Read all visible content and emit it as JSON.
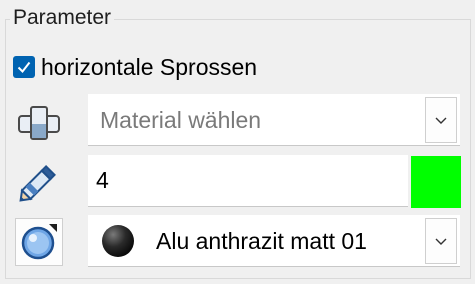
{
  "group": {
    "title": "Parameter"
  },
  "checkbox": {
    "label": "horizontale Sprossen",
    "checked": true
  },
  "material_combo": {
    "placeholder": "Material wählen"
  },
  "width_field": {
    "value": "4"
  },
  "color": {
    "value": "#00ff00"
  },
  "finish_combo": {
    "selected": "Alu anthrazit matt 01"
  },
  "icons": {
    "row1": "muntin-profile-icon",
    "row2": "pencil-icon",
    "row3": "color-wheel-icon",
    "finish": "material-sphere-icon",
    "dropdown": "chevron-down-icon"
  },
  "colors": {
    "accent": "#0063b1",
    "border": "#d9d9d9",
    "background": "#f0f0f0"
  }
}
